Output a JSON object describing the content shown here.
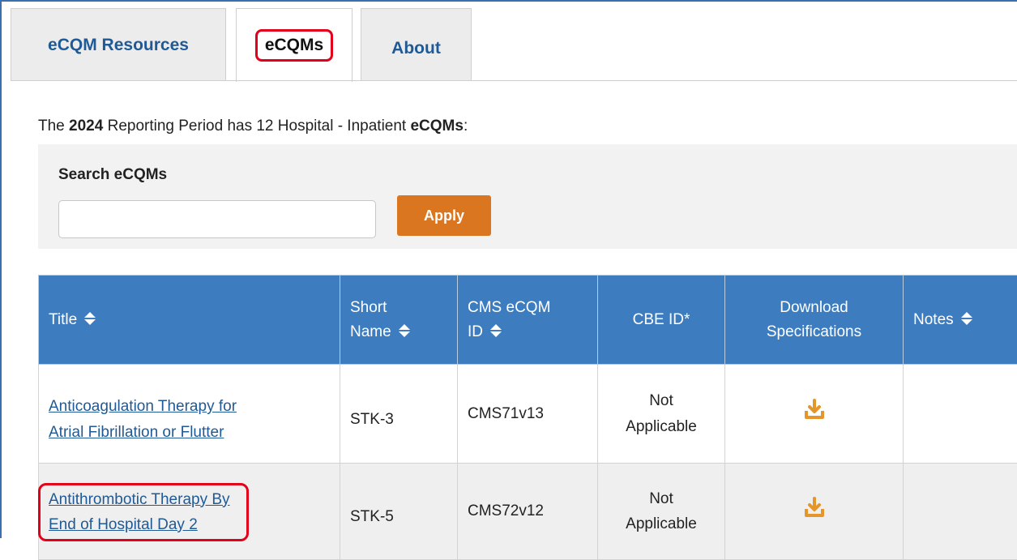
{
  "tabs": [
    {
      "label": "eCQM Resources",
      "active": false
    },
    {
      "label": "eCQMs",
      "active": true
    },
    {
      "label": "About",
      "active": false
    }
  ],
  "intro": {
    "prefix": "The ",
    "year": "2024",
    "middle": " Reporting Period has 12 Hospital - Inpatient ",
    "emph": "eCQMs",
    "suffix": ":"
  },
  "search": {
    "label": "Search eCQMs",
    "value": "",
    "placeholder": "",
    "apply_label": "Apply"
  },
  "table": {
    "headers": {
      "title": "Title",
      "short_name_1": "Short",
      "short_name_2": "Name",
      "cms_id_1": "CMS eCQM",
      "cms_id_2": "ID",
      "cbe_id": "CBE ID*",
      "download_1": "Download",
      "download_2": "Specifications",
      "notes": "Notes"
    },
    "rows": [
      {
        "title_line1": "Anticoagulation Therapy for",
        "title_line2": "Atrial Fibrillation or Flutter",
        "short_name": "STK-3",
        "cms_id": "CMS71v13",
        "cbe_line1": "Not",
        "cbe_line2": "Applicable",
        "notes": ""
      },
      {
        "title_line1": "Antithrombotic Therapy By",
        "title_line2": "End of Hospital Day 2",
        "short_name": "STK-5",
        "cms_id": "CMS72v12",
        "cbe_line1": "Not",
        "cbe_line2": "Applicable",
        "notes": ""
      }
    ]
  },
  "colors": {
    "header_bg": "#3d7dbf",
    "link": "#1f5a96",
    "apply_bg": "#d9761f",
    "highlight": "#e3001b",
    "download_icon": "#e5962a"
  },
  "icons": {
    "sort": "sort-icon",
    "download": "download-icon"
  }
}
